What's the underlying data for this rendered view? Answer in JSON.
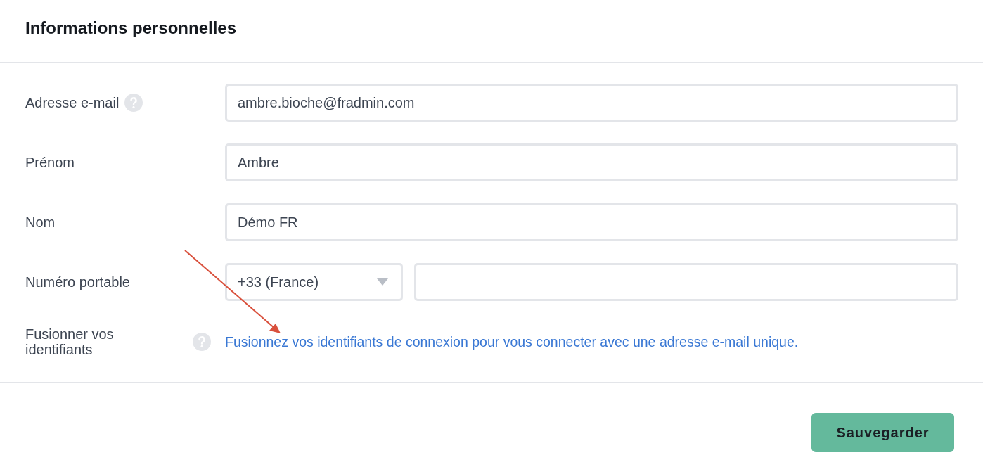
{
  "title": "Informations personnelles",
  "fields": [
    {
      "kind": "text",
      "label": "Adresse e-mail",
      "help": true,
      "value": "ambre.bioche@fradmin.com"
    },
    {
      "kind": "text",
      "label": "Prénom",
      "help": false,
      "value": "Ambre"
    },
    {
      "kind": "text",
      "label": "Nom",
      "help": false,
      "value": "Démo FR"
    },
    {
      "kind": "phone",
      "label": "Numéro portable",
      "help": false,
      "country": "+33 (France)"
    },
    {
      "kind": "link",
      "label": "Fusionner vos identifiants",
      "help": true,
      "link": "Fusionnez vos identifiants de connexion pour vous connecter avec une adresse e-mail unique."
    }
  ],
  "save_button": "Sauvegarder"
}
